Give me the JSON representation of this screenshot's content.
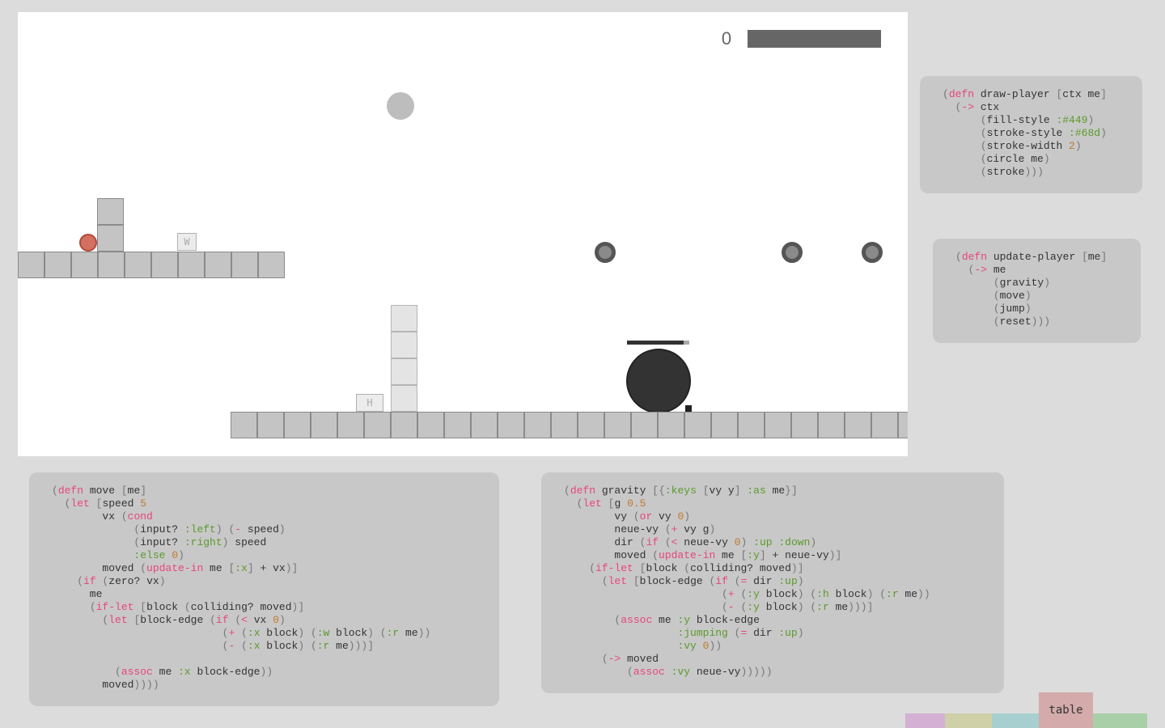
{
  "hud": {
    "score": "0",
    "health_fraction": 1.0
  },
  "signs": {
    "upper": "W",
    "lower": "H"
  },
  "colors": {
    "player": "#d4705f",
    "boss": "#333333",
    "tile": "#c4c4c4",
    "panel": "#c8c8c8",
    "keyword": "#e8457a",
    "keyword_arg": "#5a9a2a",
    "number": "#c07a30"
  },
  "code": {
    "draw_player": [
      "(defn draw-player [ctx me]",
      "  (-> ctx",
      "      (fill-style :#449)",
      "      (stroke-style :#68d)",
      "      (stroke-width 2)",
      "      (circle me)",
      "      (stroke)))"
    ],
    "update_player": [
      "(defn update-player [me]",
      "  (-> me",
      "      (gravity)",
      "      (move)",
      "      (jump)",
      "      (reset)))"
    ],
    "move": [
      "(defn move [me]",
      "  (let [speed 5",
      "        vx (cond",
      "             (input? :left) (- speed)",
      "             (input? :right) speed",
      "             :else 0)",
      "        moved (update-in me [:x] + vx)]",
      "    (if (zero? vx)",
      "      me",
      "      (if-let [block (colliding? moved)]",
      "        (let [block-edge (if (< vx 0)",
      "                           (+ (:x block) (:w block) (:r me))",
      "                           (- (:x block) (:r me)))]",
      "",
      "          (assoc me :x block-edge))",
      "        moved))))"
    ],
    "gravity": [
      "(defn gravity [{:keys [vy y] :as me}]",
      "  (let [g 0.5",
      "        vy (or vy 0)",
      "        neue-vy (+ vy g)",
      "        dir (if (< neue-vy 0) :up :down)",
      "        moved (update-in me [:y] + neue-vy)]",
      "    (if-let [block (colliding? moved)]",
      "      (let [block-edge (if (= dir :up)",
      "                         (+ (:y block) (:h block) (:r me))",
      "                         (- (:y block) (:r me)))]",
      "        (assoc me :y block-edge",
      "                  :jumping (= dir :up)",
      "                  :vy 0))",
      "      (-> moved",
      "          (assoc :vy neue-vy)))))"
    ]
  },
  "tabs": {
    "active_label": "table",
    "items": [
      {
        "color": "#d4b0d4"
      },
      {
        "color": "#cfcfa8"
      },
      {
        "color": "#a8cfcf"
      },
      {
        "color": "#d4aaaa"
      },
      {
        "color": "#a8cfa8"
      }
    ]
  }
}
